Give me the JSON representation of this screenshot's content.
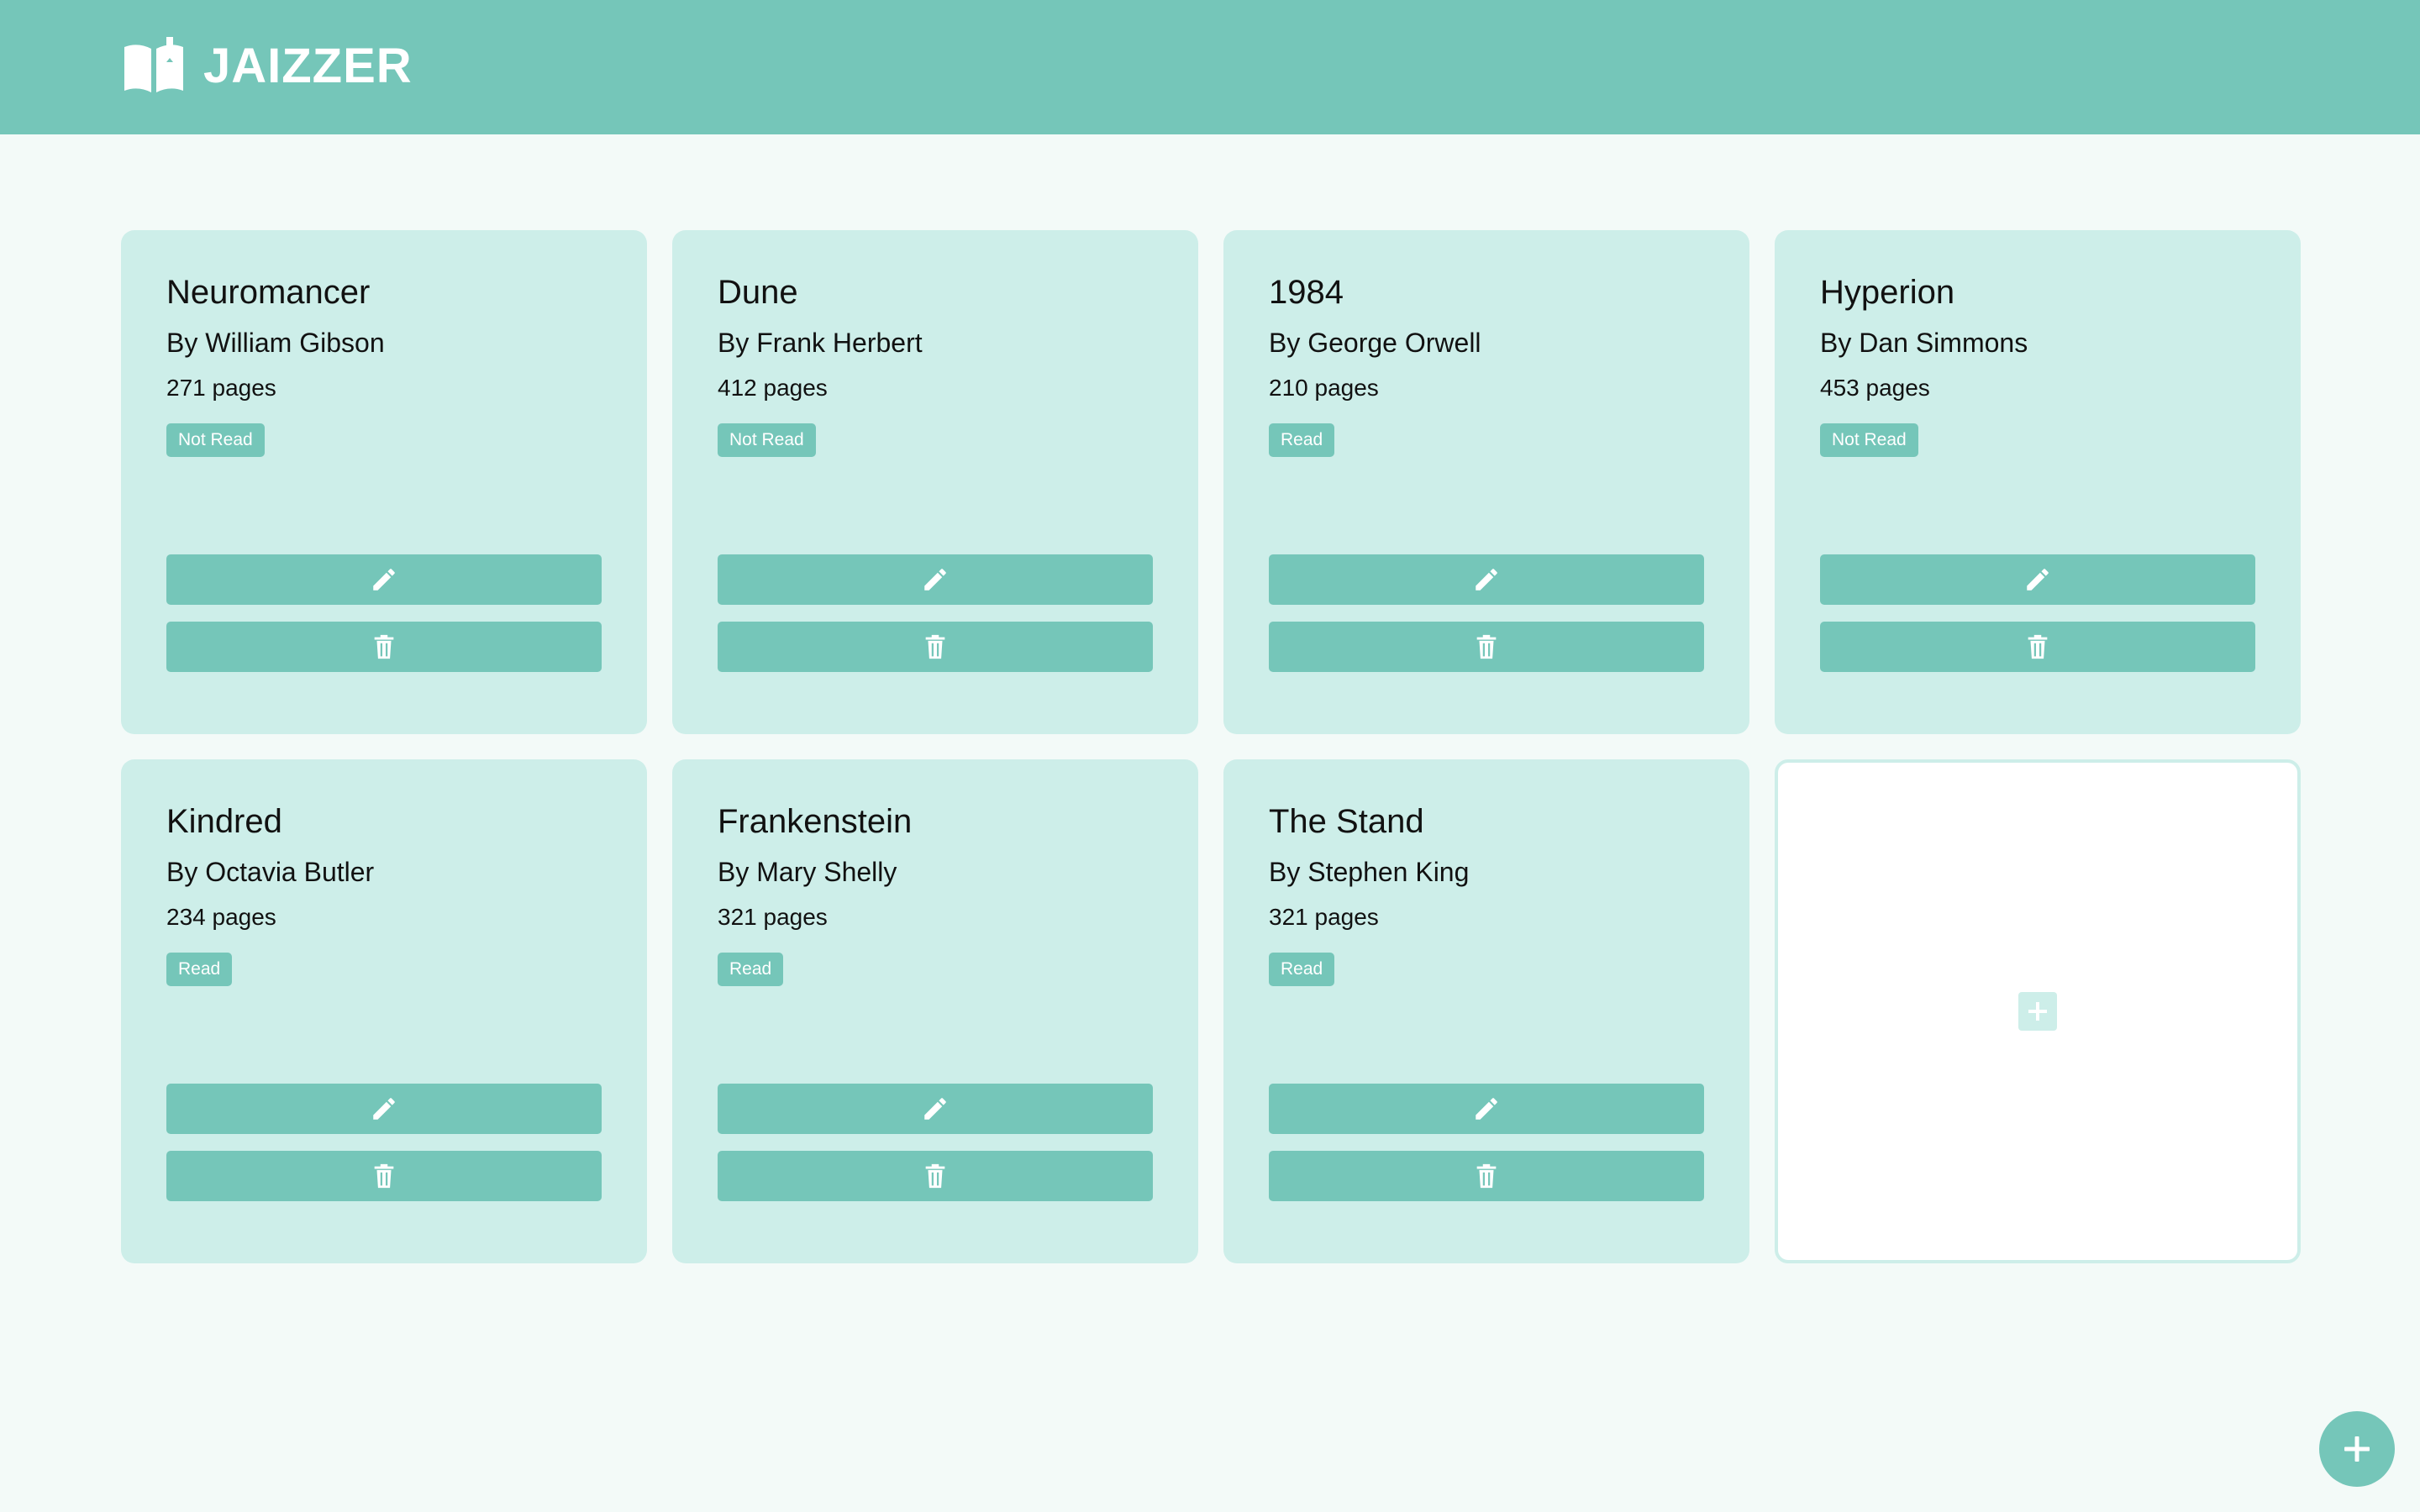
{
  "header": {
    "brand_name": "JAIZZER",
    "logo_icon": "open-book-icon"
  },
  "colors": {
    "header_bg": "#75c6b9",
    "page_bg": "#f3faf8",
    "card_bg": "#cdeee9",
    "accent": "#75c6b9"
  },
  "books": [
    {
      "title": "Neuromancer",
      "author": "By William Gibson",
      "pages": "271 pages",
      "status": "Not Read"
    },
    {
      "title": "Dune",
      "author": "By Frank Herbert",
      "pages": "412 pages",
      "status": "Not Read"
    },
    {
      "title": "1984",
      "author": "By George Orwell",
      "pages": "210 pages",
      "status": "Read"
    },
    {
      "title": "Hyperion",
      "author": "By Dan Simmons",
      "pages": "453 pages",
      "status": "Not Read"
    },
    {
      "title": "Kindred",
      "author": "By Octavia Butler",
      "pages": "234 pages",
      "status": "Read"
    },
    {
      "title": "Frankenstein",
      "author": "By Mary Shelly",
      "pages": "321 pages",
      "status": "Read"
    },
    {
      "title": "The Stand",
      "author": "By Stephen King",
      "pages": "321 pages",
      "status": "Read"
    }
  ],
  "card_actions": {
    "edit_icon": "pencil-icon",
    "delete_icon": "trash-icon"
  },
  "add_card": {
    "icon": "plus-square-icon"
  },
  "fab": {
    "icon": "plus-icon"
  }
}
